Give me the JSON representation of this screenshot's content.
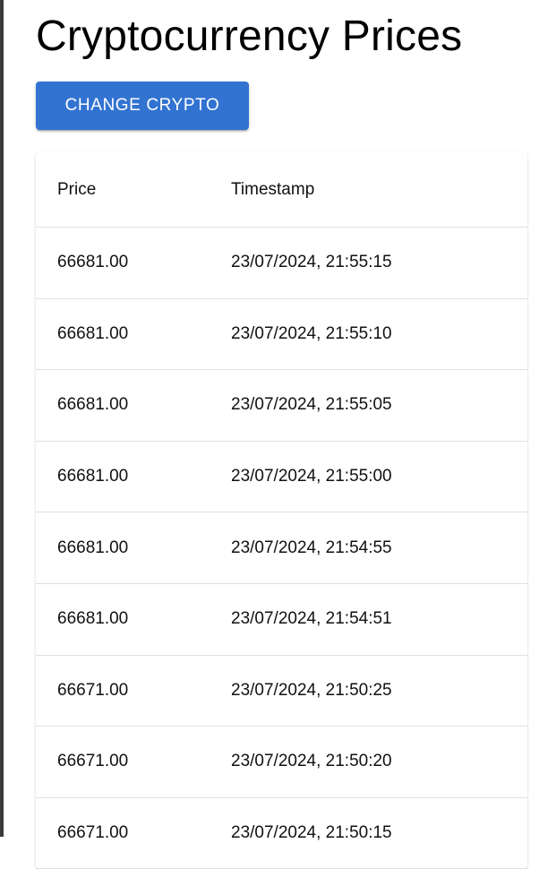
{
  "page": {
    "title": "Cryptocurrency Prices"
  },
  "toolbar": {
    "change_label": "CHANGE CRYPTO"
  },
  "table": {
    "columns": [
      "Price",
      "Timestamp"
    ],
    "rows": [
      {
        "price": "66681.00",
        "timestamp": "23/07/2024, 21:55:15"
      },
      {
        "price": "66681.00",
        "timestamp": "23/07/2024, 21:55:10"
      },
      {
        "price": "66681.00",
        "timestamp": "23/07/2024, 21:55:05"
      },
      {
        "price": "66681.00",
        "timestamp": "23/07/2024, 21:55:00"
      },
      {
        "price": "66681.00",
        "timestamp": "23/07/2024, 21:54:55"
      },
      {
        "price": "66681.00",
        "timestamp": "23/07/2024, 21:54:51"
      },
      {
        "price": "66671.00",
        "timestamp": "23/07/2024, 21:50:25"
      },
      {
        "price": "66671.00",
        "timestamp": "23/07/2024, 21:50:20"
      },
      {
        "price": "66671.00",
        "timestamp": "23/07/2024, 21:50:15"
      }
    ]
  },
  "colors": {
    "accent": "#3273d1",
    "divider": "#e0e0e0"
  }
}
